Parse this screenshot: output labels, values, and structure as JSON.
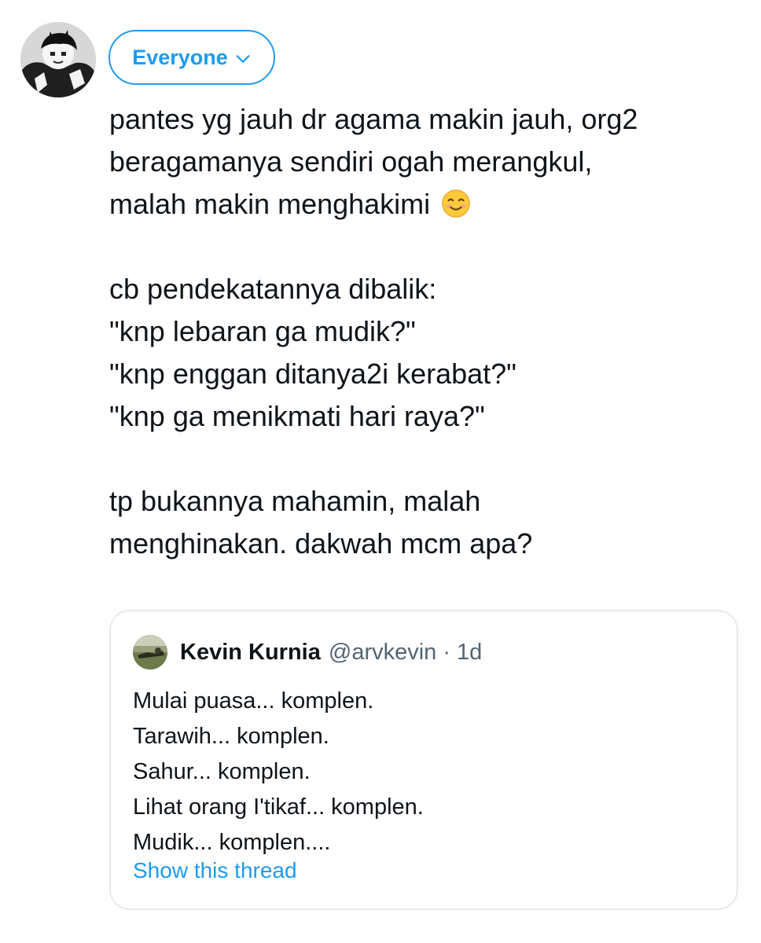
{
  "audience": {
    "label": "Everyone",
    "icon": "chevron-down-icon",
    "accent_color": "#1d9bf0"
  },
  "tweet": {
    "lines": [
      "pantes yg jauh dr agama makin jauh, org2",
      "beragamanya sendiri ogah merangkul,",
      "malah makin menghakimi",
      "",
      "cb pendekatannya dibalik:",
      "\"knp lebaran ga mudik?\"",
      "\"knp enggan ditanya2i kerabat?\"",
      "\"knp ga menikmati hari raya?\"",
      "",
      "tp bukannya mahamin, malah",
      "menghinakan. dakwah mcm apa?"
    ],
    "emoji": "smiling-face-icon"
  },
  "quote": {
    "name": "Kevin Kurnia",
    "handle": "@arvkevin",
    "separator": "·",
    "time": "1d",
    "lines": [
      "Mulai puasa... komplen.",
      "Tarawih... komplen.",
      "Sahur... komplen.",
      "Lihat orang I'tikaf... komplen.",
      "Mudik... komplen...."
    ],
    "show_thread": "Show this thread"
  },
  "colors": {
    "text": "#0f1419",
    "secondary_text": "#536471",
    "link": "#1d9bf0",
    "card_border": "#e7eaee"
  }
}
